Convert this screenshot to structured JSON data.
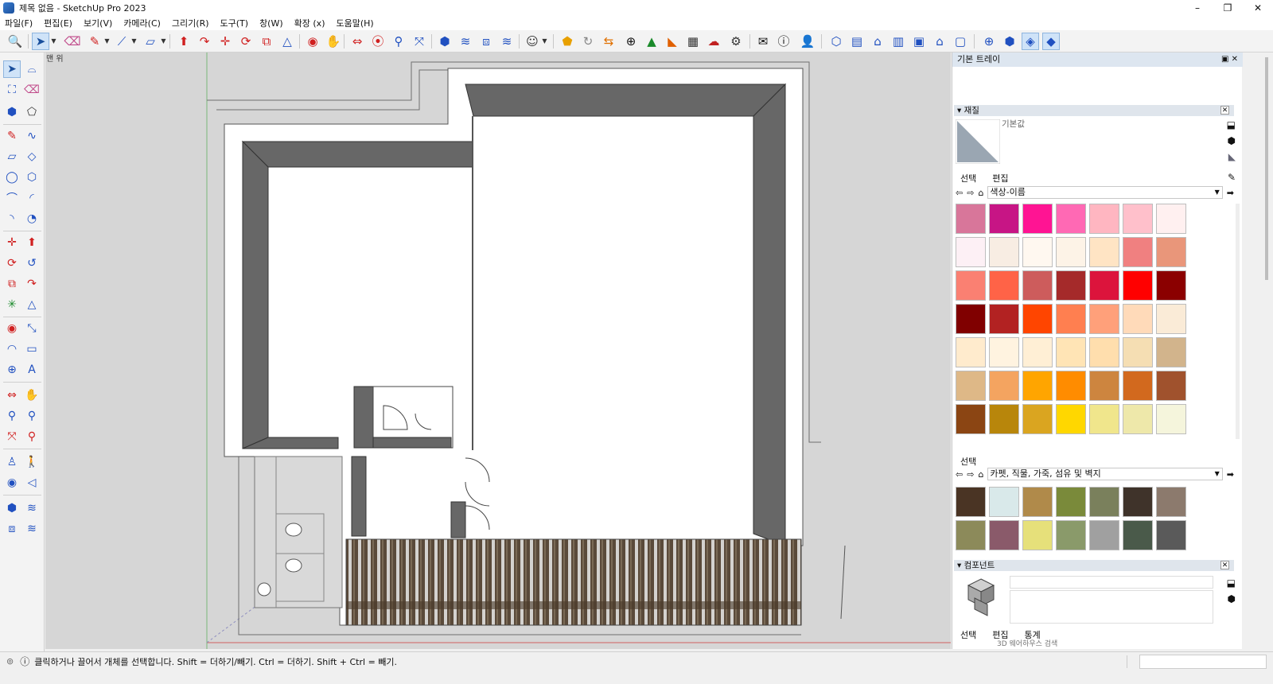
{
  "window": {
    "title": "제목 없음 - SketchUp Pro 2023",
    "minimize": "–",
    "maximize": "❐",
    "close": "✕"
  },
  "menu": [
    "파일(F)",
    "편집(E)",
    "보기(V)",
    "카메라(C)",
    "그리기(R)",
    "도구(T)",
    "창(W)",
    "확장 (x)",
    "도움말(H)"
  ],
  "toolbar": {
    "icons": [
      "search-icon",
      "select-icon",
      "dropdown-caret-icon",
      "eraser-icon",
      "pencil-icon",
      "dropdown-caret-icon",
      "line-icon",
      "dropdown-caret-icon",
      "rectangle-icon",
      "dropdown-caret-icon",
      "push-pull-icon",
      "offset-icon",
      "move-icon",
      "rotate-icon",
      "scale-icon",
      "tape-measure-icon",
      "orbit-icon",
      "pan-icon",
      "zoom-icon",
      "zoom-extents-icon",
      "walk-icon",
      "look-around-icon",
      "position-camera-icon",
      "section-plane-icon",
      "components-icon",
      "tags-icon",
      "styles-icon",
      "account-icon",
      "warehouse-icon",
      "refresh-icon",
      "exchange-icon",
      "add-icon",
      "tree-icon",
      "layers-icon",
      "checker-icon",
      "cloud-upload-icon",
      "settings-icon",
      "mail-icon",
      "info-icon",
      "user-icon",
      "iso-view-icon",
      "top-view-icon",
      "front-view-icon",
      "right-view-icon",
      "back-view-icon",
      "left-view-icon",
      "axes-icon",
      "xray-icon",
      "back-edges-icon",
      "shaded-icon"
    ]
  },
  "left_toolbar": {
    "icons": [
      "select-icon",
      "lasso-icon",
      "paint-bucket-icon",
      "eraser-icon",
      "make-component-icon",
      "tag-eraser-icon",
      "pencil-icon",
      "freehand-icon",
      "rectangle-icon",
      "rotated-rectangle-icon",
      "circle-icon",
      "polygon-icon",
      "arc-icon",
      "two-point-arc-icon",
      "three-point-arc-icon",
      "pie-icon",
      "move-icon",
      "push-pull-icon",
      "rotate-icon",
      "follow-me-icon",
      "scale-icon",
      "offset-icon",
      "axes-icon",
      "section-plane-icon",
      "tape-measure-icon",
      "dimension-icon",
      "protractor-icon",
      "text-icon",
      "axis-icon",
      "3d-text-icon",
      "orbit-icon",
      "pan-icon",
      "zoom-icon",
      "zoom-window-icon",
      "zoom-extents-icon",
      "previous-view-icon",
      "position-camera-icon",
      "walk-icon",
      "look-around-icon",
      "section-fill-icon",
      "components-icon",
      "tags-icon",
      "styles-icon",
      "scenes-icon"
    ]
  },
  "viewport": {
    "scene_label": "맨 위"
  },
  "tray": {
    "title": "기본 트레이",
    "materials": {
      "header": "재질",
      "default_name": "기본값",
      "tabs": [
        "선택",
        "편집"
      ],
      "collection": "색상-이름",
      "colors": [
        "#d8769a",
        "#c71585",
        "#ff1493",
        "#ff69b4",
        "#ffb6c1",
        "#ffc0cb",
        "#fff0f0",
        "#fdf0f5",
        "#f8ede3",
        "#fff8f0",
        "#fdf3e7",
        "#ffe4c4",
        "#f08080",
        "#e9967a",
        "#fa8072",
        "#ff6347",
        "#cd5c5c",
        "#a52a2a",
        "#dc143c",
        "#ff0000",
        "#8b0000",
        "#800000",
        "#b22222",
        "#ff4500",
        "#ff7f50",
        "#ffa07a",
        "#ffdab9",
        "#faebd7",
        "#ffebcd",
        "#fff3e0",
        "#ffefd5",
        "#ffe4b5",
        "#ffdead",
        "#f5deb3",
        "#d2b48c",
        "#deb887",
        "#f4a460",
        "#ffa500",
        "#ff8c00",
        "#cd853f",
        "#d2691e",
        "#a0522d",
        "#8b4513",
        "#b8860b",
        "#daa520",
        "#ffd700",
        "#f0e68c",
        "#eee8aa",
        "#f5f5dc"
      ],
      "secondary_collection": "카펫, 직물, 가죽, 섬유 및 벽지",
      "texture_colors": [
        "#4a3424",
        "#d9e9ea",
        "#b08a4a",
        "#7a8a3a",
        "#7a805c",
        "#3f332a",
        "#8c7a6d",
        "#8c8a5a",
        "#8a5a6a",
        "#e6e07a",
        "#8a9a6a",
        "#a0a0a0",
        "#4a5a4a",
        "#5a5a5a"
      ]
    },
    "components": {
      "header": "컴포넌트",
      "tabs": [
        "선택",
        "편집",
        "통계"
      ],
      "search_placeholder": "3D 웨어하우스 검색"
    }
  },
  "status": {
    "text": "클릭하거나 끌어서 개체를 선택합니다. Shift = 더하기/빼기. Ctrl = 더하기. Shift + Ctrl = 빼기."
  }
}
